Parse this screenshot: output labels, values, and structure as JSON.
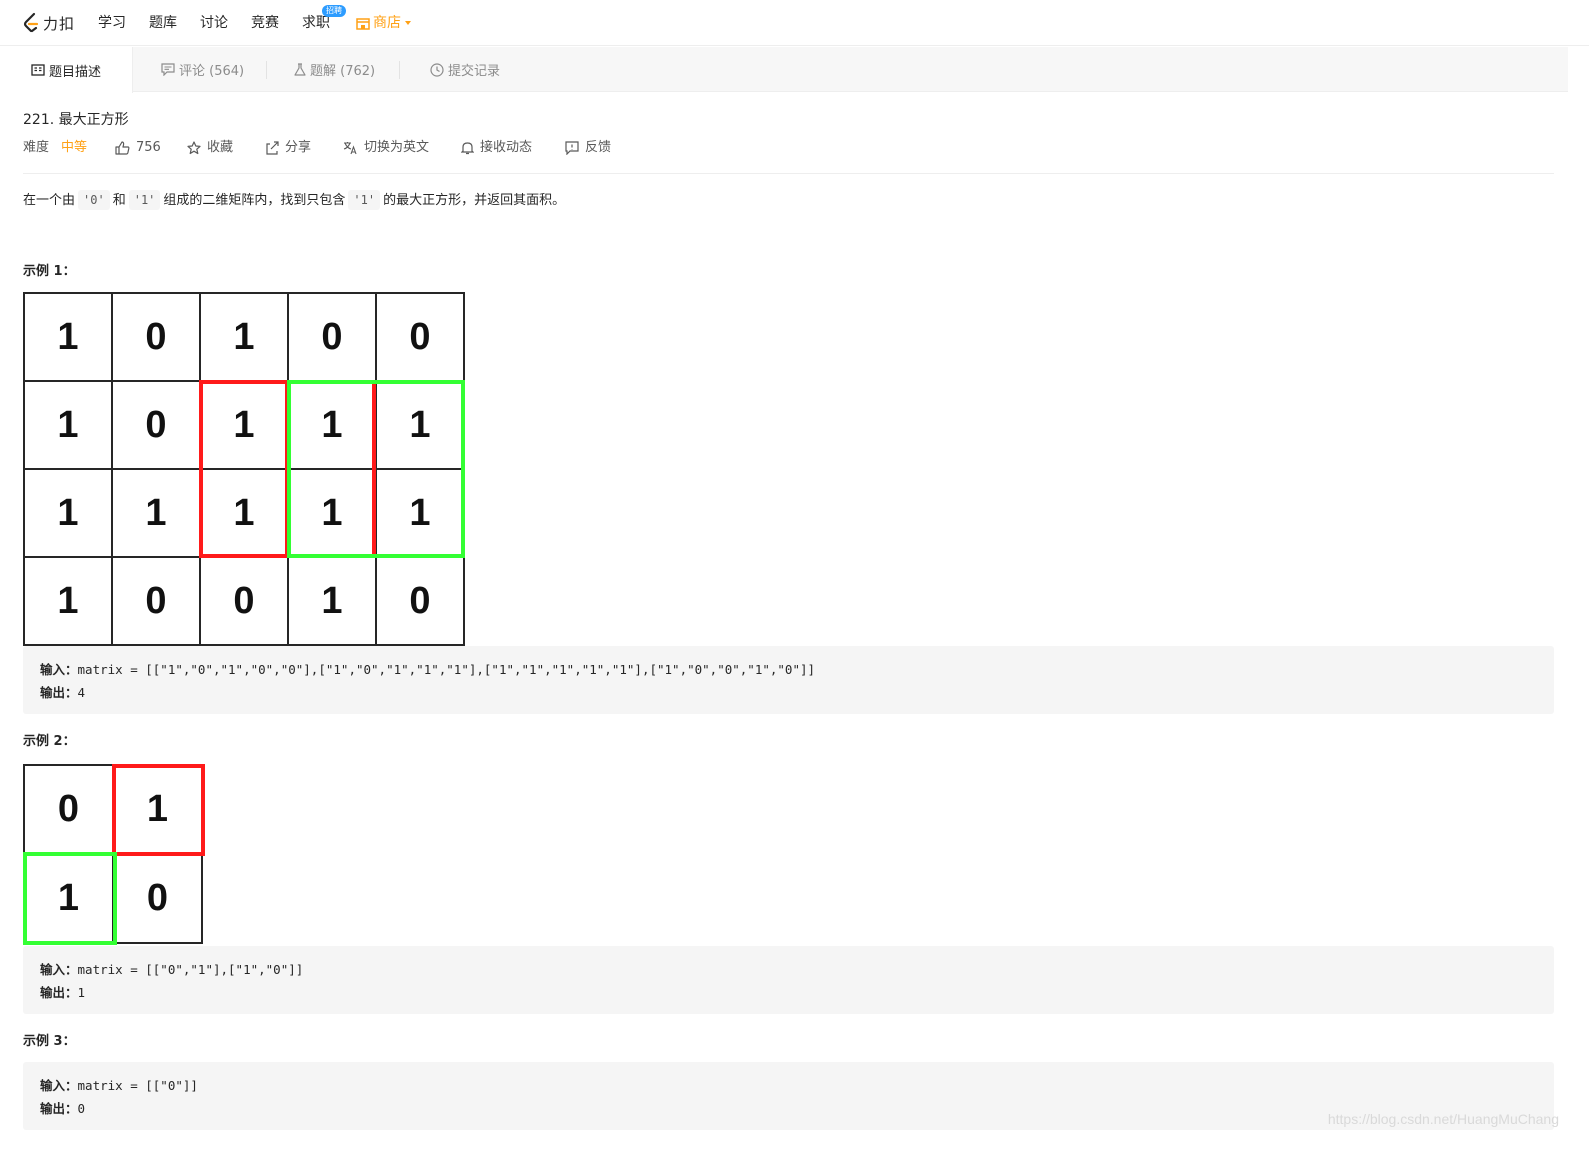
{
  "nav": {
    "logo_text": "力扣",
    "items": [
      "学习",
      "题库",
      "讨论",
      "竞赛",
      "求职"
    ],
    "badge": "招聘",
    "shop_label": "商店"
  },
  "tabs": [
    {
      "label": "题目描述",
      "icon": "description-icon"
    },
    {
      "label": "评论 (564)",
      "icon": "comment-icon"
    },
    {
      "label": "题解 (762)",
      "icon": "flask-icon"
    },
    {
      "label": "提交记录",
      "icon": "clock-icon"
    }
  ],
  "problem": {
    "title": "221. 最大正方形",
    "difficulty_label": "难度",
    "difficulty": "中等",
    "likes": "756",
    "favorite": "收藏",
    "share": "分享",
    "translate": "切换为英文",
    "subscribe": "接收动态",
    "feedback": "反馈",
    "desc_part1": "在一个由",
    "code0": "'0'",
    "desc_part2": "和",
    "code1": "'1'",
    "desc_part3": "组成的二维矩阵内，找到只包含",
    "code2": "'1'",
    "desc_part4": "的最大正方形，并返回其面积。"
  },
  "examples": [
    {
      "label": "示例 1：",
      "matrix": [
        [
          "1",
          "0",
          "1",
          "0",
          "0"
        ],
        [
          "1",
          "0",
          "1",
          "1",
          "1"
        ],
        [
          "1",
          "1",
          "1",
          "1",
          "1"
        ],
        [
          "1",
          "0",
          "0",
          "1",
          "0"
        ]
      ],
      "input_label": "输入：",
      "input": "matrix = [[\"1\",\"0\",\"1\",\"0\",\"0\"],[\"1\",\"0\",\"1\",\"1\",\"1\"],[\"1\",\"1\",\"1\",\"1\",\"1\"],[\"1\",\"0\",\"0\",\"1\",\"0\"]]",
      "output_label": "输出：",
      "output": "4"
    },
    {
      "label": "示例 2：",
      "matrix": [
        [
          "0",
          "1"
        ],
        [
          "1",
          "0"
        ]
      ],
      "input_label": "输入：",
      "input": "matrix = [[\"0\",\"1\"],[\"1\",\"0\"]]",
      "output_label": "输出：",
      "output": "1"
    },
    {
      "label": "示例 3：",
      "input_label": "输入：",
      "input": "matrix = [[\"0\"]]",
      "output_label": "输出：",
      "output": "0"
    }
  ],
  "colors": {
    "accent": "#ffa116",
    "badge": "#2d9cff",
    "highlight_red": "#ff1a1a",
    "highlight_green": "#33ff33"
  },
  "watermark": "https://blog.csdn.net/HuangMuChang"
}
